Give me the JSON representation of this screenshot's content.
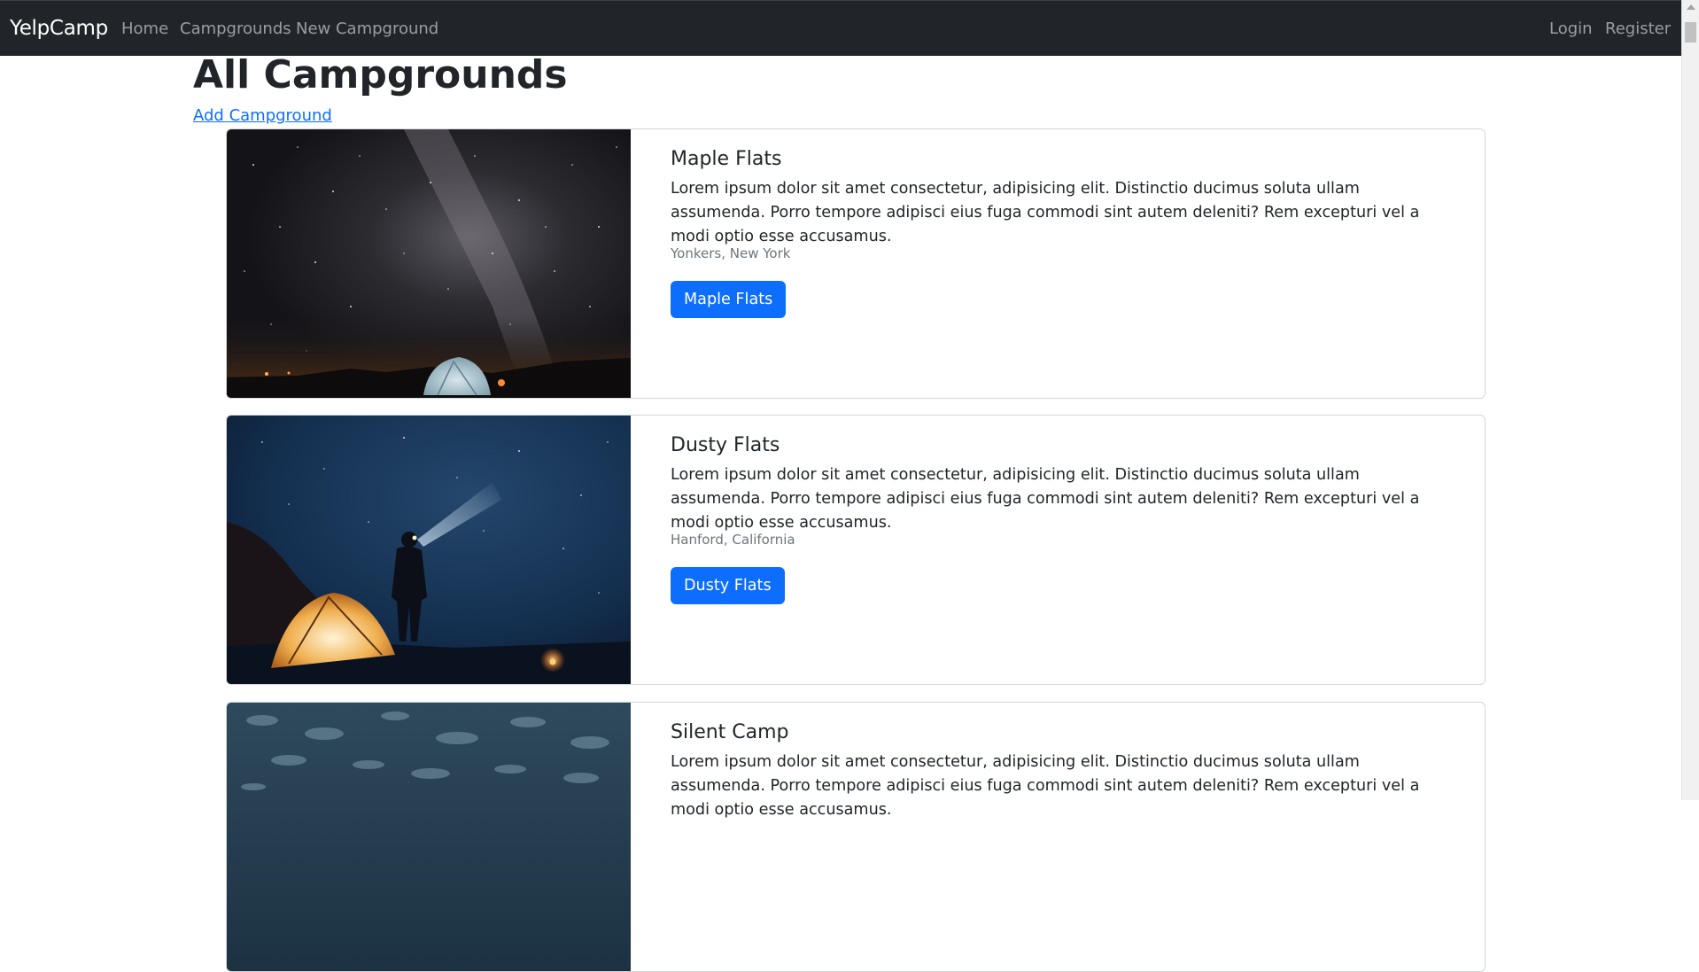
{
  "navbar": {
    "brand": "YelpCamp",
    "links": [
      "Home",
      "Campgrounds",
      "New Campground"
    ],
    "auth_links": [
      "Login",
      "Register"
    ]
  },
  "page": {
    "title": "All Campgrounds",
    "add_link": "Add Campground"
  },
  "campgrounds": [
    {
      "title": "Maple Flats",
      "description": "Lorem ipsum dolor sit amet consectetur, adipisicing elit. Distinctio ducimus soluta ullam assumenda. Porro tempore adipisci eius fuga commodi sint autem deleniti? Rem excepturi vel a modi optio esse accusamus.",
      "location": "Yonkers, New York",
      "button": "Maple Flats",
      "image": "night-sky-tent-photo"
    },
    {
      "title": "Dusty Flats",
      "description": "Lorem ipsum dolor sit amet consectetur, adipisicing elit. Distinctio ducimus soluta ullam assumenda. Porro tempore adipisci eius fuga commodi sint autem deleniti? Rem excepturi vel a modi optio esse accusamus.",
      "location": "Hanford, California",
      "button": "Dusty Flats",
      "image": "hiker-headlamp-tent-photo"
    },
    {
      "title": "Silent Camp",
      "description": "Lorem ipsum dolor sit amet consectetur, adipisicing elit. Distinctio ducimus soluta ullam assumenda. Porro tempore adipisci eius fuga commodi sint autem deleniti? Rem excepturi vel a modi optio esse accusamus.",
      "location": "",
      "button": "",
      "image": "cloudy-sky-photo"
    }
  ],
  "colors": {
    "navbar_bg": "#212529",
    "primary": "#0d6efd",
    "muted": "#6c757d"
  }
}
